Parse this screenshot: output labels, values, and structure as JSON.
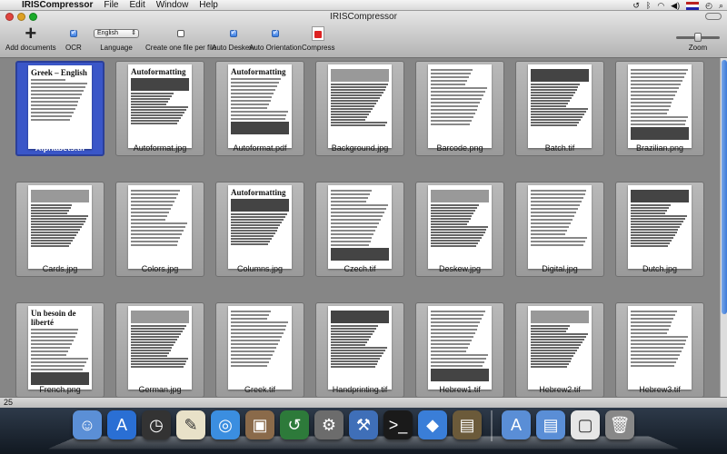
{
  "menubar": {
    "app_name": "IRISCompressor",
    "menus": [
      "File",
      "Edit",
      "Window",
      "Help"
    ],
    "time_icon": "clock-icon"
  },
  "window": {
    "title": "IRISCompressor"
  },
  "toolbar": {
    "add_documents": "Add documents",
    "ocr": "OCR",
    "ocr_checked": true,
    "language": "Language",
    "language_value": "English",
    "create_one_file": "Create one file per file",
    "create_one_file_checked": false,
    "auto_deskew": "Auto Deskew",
    "auto_deskew_checked": true,
    "auto_orientation": "Auto Orientation",
    "auto_orientation_checked": true,
    "compress": "Compress",
    "zoom": "Zoom",
    "zoom_level": 0.45
  },
  "documents": [
    {
      "name": "Alphabets.tif",
      "headline": "Greek – English",
      "selected": true
    },
    {
      "name": "Autoformat.jpg",
      "headline": "Autoformatting",
      "selected": false
    },
    {
      "name": "Autoformat.pdf",
      "headline": "Autoformatting",
      "selected": false
    },
    {
      "name": "Background.jpg",
      "headline": "",
      "selected": false
    },
    {
      "name": "Barcode.png",
      "headline": "",
      "selected": false
    },
    {
      "name": "Batch.tif",
      "headline": "",
      "selected": false
    },
    {
      "name": "Brazilian.png",
      "headline": "",
      "selected": false
    },
    {
      "name": "Cards.jpg",
      "headline": "",
      "selected": false
    },
    {
      "name": "Colors.jpg",
      "headline": "",
      "selected": false
    },
    {
      "name": "Columns.jpg",
      "headline": "Autoformatting",
      "selected": false
    },
    {
      "name": "Czech.tif",
      "headline": "",
      "selected": false
    },
    {
      "name": "Deskew.jpg",
      "headline": "",
      "selected": false
    },
    {
      "name": "Digital.jpg",
      "headline": "",
      "selected": false
    },
    {
      "name": "Dutch.jpg",
      "headline": "",
      "selected": false
    },
    {
      "name": "French.png",
      "headline": "Un besoin de liberté",
      "selected": false
    },
    {
      "name": "German.jpg",
      "headline": "",
      "selected": false
    },
    {
      "name": "Greek.tif",
      "headline": "",
      "selected": false
    },
    {
      "name": "Handprinting.tif",
      "headline": "",
      "selected": false
    },
    {
      "name": "Hebrew1.tif",
      "headline": "",
      "selected": false
    },
    {
      "name": "Hebrew2.tif",
      "headline": "",
      "selected": false
    },
    {
      "name": "Hebrew3.tif",
      "headline": "",
      "selected": false
    }
  ],
  "status": {
    "count": "25"
  },
  "dock": {
    "items": [
      "finder-icon",
      "app-store-icon",
      "dashboard-icon",
      "textedit-icon",
      "safari-icon",
      "preview-icon",
      "time-machine-icon",
      "system-preferences-icon",
      "xcode-icon",
      "terminal-icon",
      "iris-compressor-icon",
      "archive-utility-icon",
      "applications-folder-icon",
      "documents-folder-icon",
      "document-icon",
      "trash-icon"
    ]
  },
  "colors": {
    "selection": "#3a56c8",
    "accent": "#3c7ad8"
  }
}
